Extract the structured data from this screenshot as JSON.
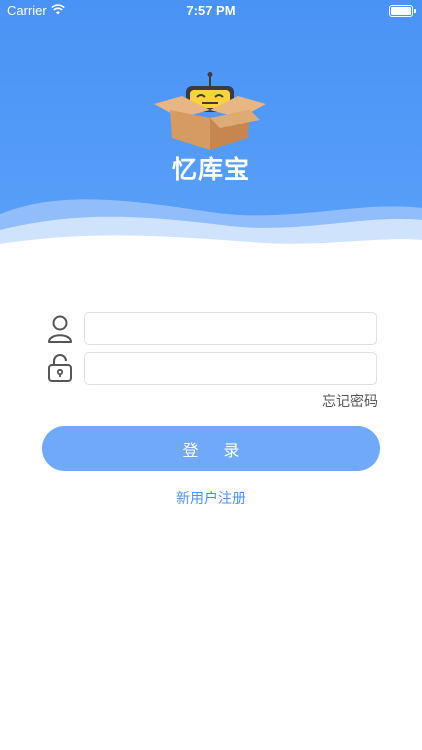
{
  "status_bar": {
    "carrier": "Carrier",
    "time": "7:57 PM",
    "battery_level": 1.0
  },
  "brand": {
    "app_name": "忆库宝",
    "logo_icon": "robot-in-box-logo"
  },
  "form": {
    "username": {
      "icon": "user-icon",
      "value": "",
      "placeholder": ""
    },
    "password": {
      "icon": "lock-icon",
      "value": "",
      "placeholder": ""
    },
    "forgot_password_label": "忘记密码",
    "login_label": "登 录",
    "register_label": "新用户注册"
  },
  "colors": {
    "primary": "#4a93f6",
    "button": "#6fa9f7",
    "background": "#ffffff"
  }
}
